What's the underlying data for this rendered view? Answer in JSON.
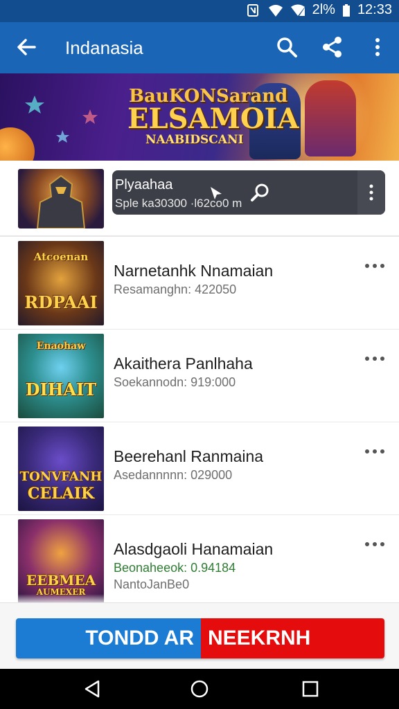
{
  "status_bar": {
    "battery": "2l%",
    "time": "12:33"
  },
  "app_bar": {
    "title": "Indanasia"
  },
  "banner": {
    "line1": "BauKONSarand",
    "line2": "ELSAMOIA",
    "line3": "NAABIDSCANI"
  },
  "featured": {
    "name": "Plyaahaa",
    "subtitle": "Sple ka30300 ·l62co0 m"
  },
  "items": [
    {
      "name": "Narnetanhk Nnamaian",
      "subtitle": "Resamanghn: 422050",
      "thumb_caption_top": "Atcoenan",
      "thumb_caption": "RDPAAI"
    },
    {
      "name": "Akaithera Panlhaha",
      "subtitle": "Soekannodn: 919:000",
      "thumb_caption_top": "Enaohaw",
      "thumb_caption": "DIHAIT"
    },
    {
      "name": "Beerehanl Ranmaina",
      "subtitle": "Asedannnnn: 029000",
      "thumb_caption_top": "TONVFANH",
      "thumb_caption": "CELAIK"
    },
    {
      "name": "Alasdgaoli Hanamaian",
      "subtitle": "Beonaheeok: 0.94184",
      "subtitle2": "NantoJanBe0",
      "thumb_caption_top": "EEBMEA",
      "thumb_caption": "AUMEXER"
    }
  ],
  "cta": {
    "left_label": "TONDD AR",
    "right_label": "NEEKRNH"
  },
  "colors": {
    "app_bar": "#1a65b5",
    "status_bar": "#114d8f",
    "cta_blue": "#1c7bd3",
    "cta_red": "#e40c0c"
  }
}
